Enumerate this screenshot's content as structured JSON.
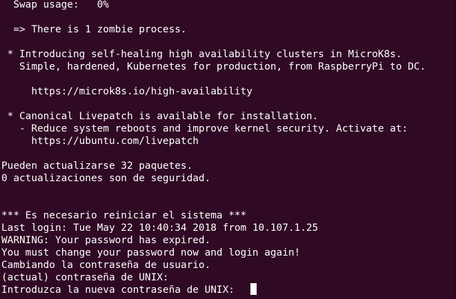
{
  "terminal": {
    "background_color": "#300a24",
    "text_color": "#ffffff",
    "lines": [
      "  Swap usage:   0%",
      "",
      "  => There is 1 zombie process.",
      "",
      " * Introducing self-healing high availability clusters in MicroK8s.",
      "   Simple, hardened, Kubernetes for production, from RaspberryPi to DC.",
      "",
      "     https://microk8s.io/high-availability",
      "",
      " * Canonical Livepatch is available for installation.",
      "   - Reduce system reboots and improve kernel security. Activate at:",
      "     https://ubuntu.com/livepatch",
      "",
      "Pueden actualizarse 32 paquetes.",
      "0 actualizaciones son de seguridad.",
      "",
      "",
      "*** Es necesario reiniciar el sistema ***",
      "Last login: Tue May 22 10:40:34 2018 from 10.107.1.25",
      "WARNING: Your password has expired.",
      "You must change your password now and login again!",
      "Cambiando la contraseña de usuario.",
      "(actual) contraseña de UNIX:",
      "Introduzca la nueva contraseña de UNIX: "
    ]
  }
}
